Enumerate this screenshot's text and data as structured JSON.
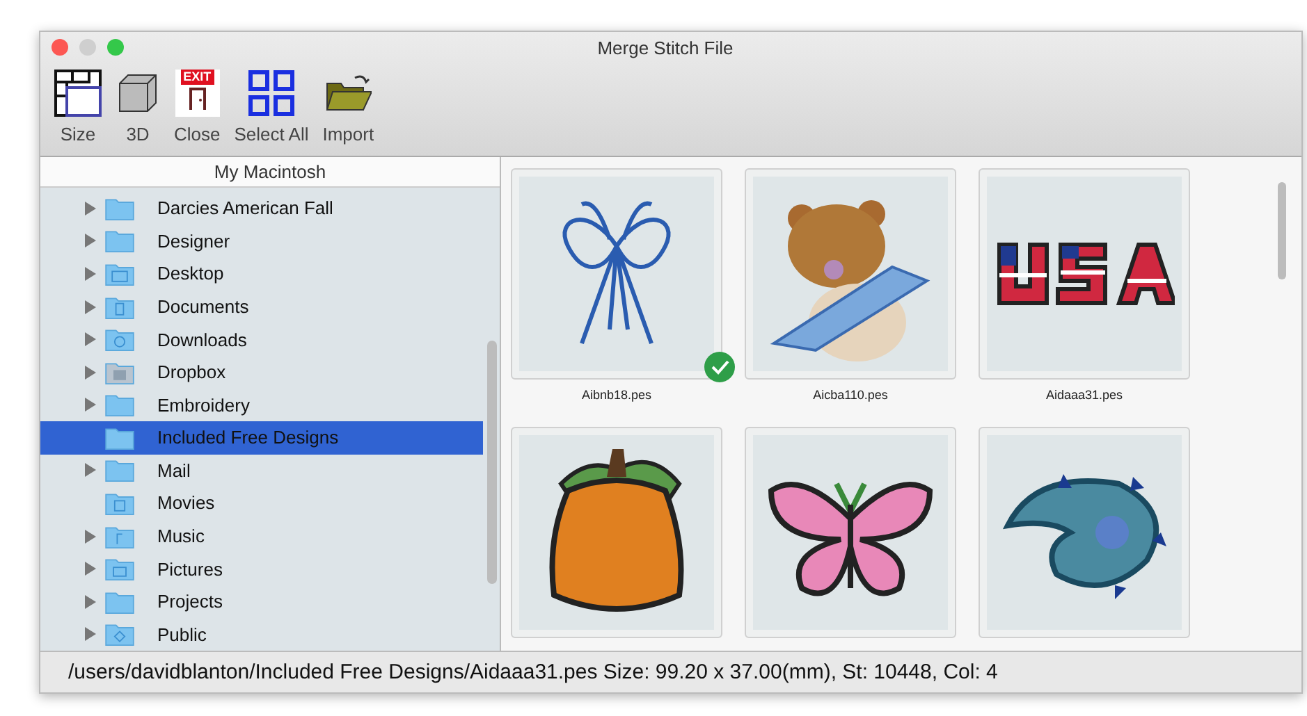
{
  "window": {
    "title": "Merge Stitch File"
  },
  "toolbar": [
    {
      "kind": "size",
      "label": "Size"
    },
    {
      "kind": "cube",
      "label": "3D"
    },
    {
      "kind": "exit",
      "label": "Close",
      "badge": "EXIT"
    },
    {
      "kind": "grid",
      "label": "Select All"
    },
    {
      "kind": "folder",
      "label": "Import"
    }
  ],
  "sidebar": {
    "header": "My Macintosh",
    "items": [
      {
        "label": "Darcies American Fall",
        "kind": "folder",
        "expandable": true,
        "selected": false
      },
      {
        "label": "Designer",
        "kind": "folder",
        "expandable": true,
        "selected": false
      },
      {
        "label": "Desktop",
        "kind": "desktop",
        "expandable": true,
        "selected": false
      },
      {
        "label": "Documents",
        "kind": "document",
        "expandable": true,
        "selected": false
      },
      {
        "label": "Downloads",
        "kind": "download",
        "expandable": true,
        "selected": false
      },
      {
        "label": "Dropbox",
        "kind": "dropbox",
        "expandable": true,
        "selected": false
      },
      {
        "label": "Embroidery",
        "kind": "folder",
        "expandable": true,
        "selected": false
      },
      {
        "label": "Included Free Designs",
        "kind": "folder",
        "expandable": false,
        "selected": true
      },
      {
        "label": "Mail",
        "kind": "folder",
        "expandable": true,
        "selected": false
      },
      {
        "label": "Movies",
        "kind": "film",
        "expandable": false,
        "selected": false
      },
      {
        "label": "Music",
        "kind": "music",
        "expandable": true,
        "selected": false
      },
      {
        "label": "Pictures",
        "kind": "camera",
        "expandable": true,
        "selected": false
      },
      {
        "label": "Projects",
        "kind": "folder",
        "expandable": true,
        "selected": false
      },
      {
        "label": "Public",
        "kind": "public",
        "expandable": true,
        "selected": false
      }
    ]
  },
  "files": [
    {
      "kind": "ribbon",
      "name": "Aibnb18.pes",
      "checked": true
    },
    {
      "kind": "bear",
      "name": "Aicba110.pes",
      "checked": false
    },
    {
      "kind": "flag-letters",
      "name": "Aidaaa31.pes",
      "checked": false
    },
    {
      "kind": "pumpkin",
      "checked": false
    },
    {
      "kind": "butterfly",
      "checked": false
    },
    {
      "kind": "paisley",
      "checked": false
    }
  ],
  "status_bar": "/users/davidblanton/Included Free Designs/Aidaaa31.pes Size: 99.20 x 37.00(mm), St: 10448, Col: 4"
}
